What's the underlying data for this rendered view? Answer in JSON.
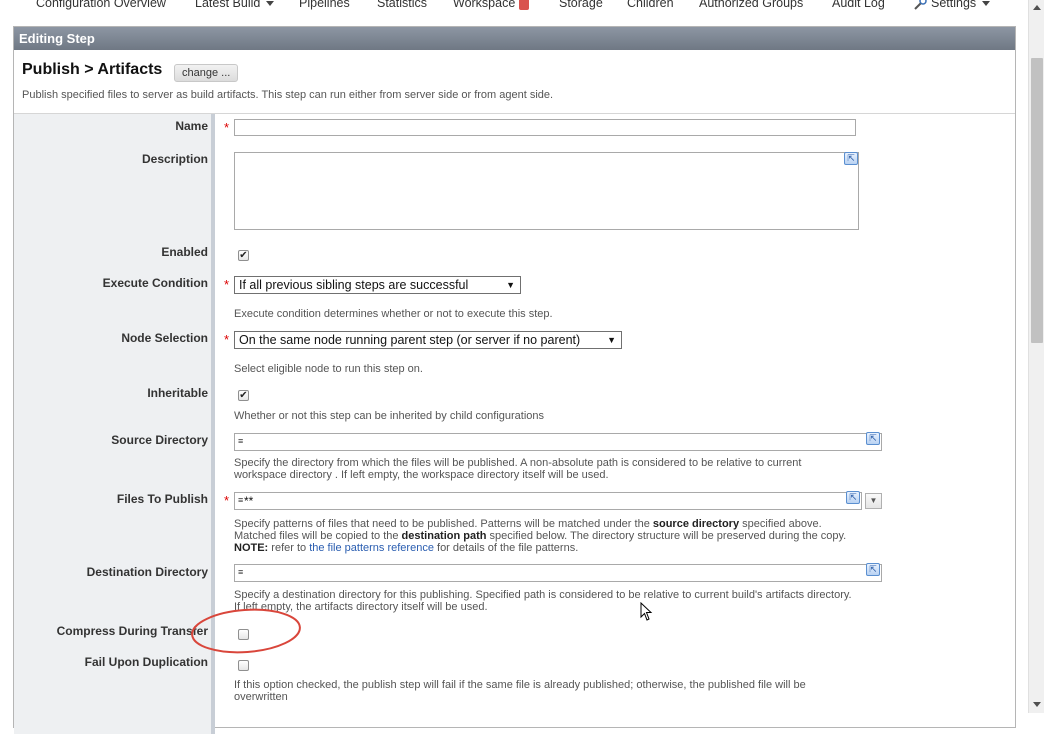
{
  "nav": {
    "items": [
      "Configuration Overview",
      "Latest Build",
      "Pipelines",
      "Statistics",
      "Workspace",
      "Storage",
      "Children",
      "Authorized Groups",
      "Audit Log",
      "Settings"
    ]
  },
  "panel": {
    "header": "Editing Step",
    "title": "Publish > Artifacts",
    "change_label": "change ...",
    "description": "Publish specified files to server as build artifacts. This step can run either from server side or from agent side."
  },
  "form": {
    "name": {
      "label": "Name",
      "value": ""
    },
    "description": {
      "label": "Description",
      "value": ""
    },
    "enabled": {
      "label": "Enabled",
      "checked": true
    },
    "execute_condition": {
      "label": "Execute Condition",
      "selected": "If all previous sibling steps are successful",
      "help": "Execute condition determines whether or not to execute this step."
    },
    "node_selection": {
      "label": "Node Selection",
      "selected": "On the same node running parent step (or server if no parent)",
      "help": "Select eligible node to run this step on."
    },
    "inheritable": {
      "label": "Inheritable",
      "checked": true,
      "help": "Whether or not this step can be inherited by child configurations"
    },
    "source_directory": {
      "label": "Source Directory",
      "value": "",
      "help_line1": "Specify the directory from which the files will be published. A non-absolute path is considered to be relative to current",
      "help_line2": "workspace directory . If left empty, the workspace directory itself will be used."
    },
    "files_to_publish": {
      "label": "Files To Publish",
      "value": "**",
      "help_a": "Specify patterns of files that need to be published. Patterns will be matched under the ",
      "help_b": "source directory",
      "help_c": " specified above.",
      "help_d": "Matched files will be copied to the ",
      "help_e": "destination path",
      "help_f": " specified below. The directory structure will be preserved during the copy.",
      "help_g": "NOTE:",
      "help_h": " refer to ",
      "help_link": "the file patterns reference",
      "help_i": " for details of the file patterns."
    },
    "destination_directory": {
      "label": "Destination Directory",
      "value": "",
      "help_line1": "Specify a destination directory for this publishing. Specified path is considered to be relative to current build's artifacts directory.",
      "help_line2": "If left empty, the artifacts directory itself will be used."
    },
    "compress": {
      "label": "Compress During Transfer",
      "checked": false
    },
    "fail_dup": {
      "label": "Fail Upon Duplication",
      "checked": false,
      "help_line1": "If this option checked, the publish step will fail if the same file is already published; otherwise, the published file will be",
      "help_line2": "overwritten"
    }
  },
  "colors": {
    "header_bg": "#7a838f",
    "label_bg": "#eef0f2",
    "required": "#dd0000",
    "link": "#2a5db0",
    "highlight_circle": "#d9463b"
  },
  "icons": {
    "settings": "wrench-icon",
    "workspace": "badge-icon",
    "editor": "expand-editor-icon"
  }
}
